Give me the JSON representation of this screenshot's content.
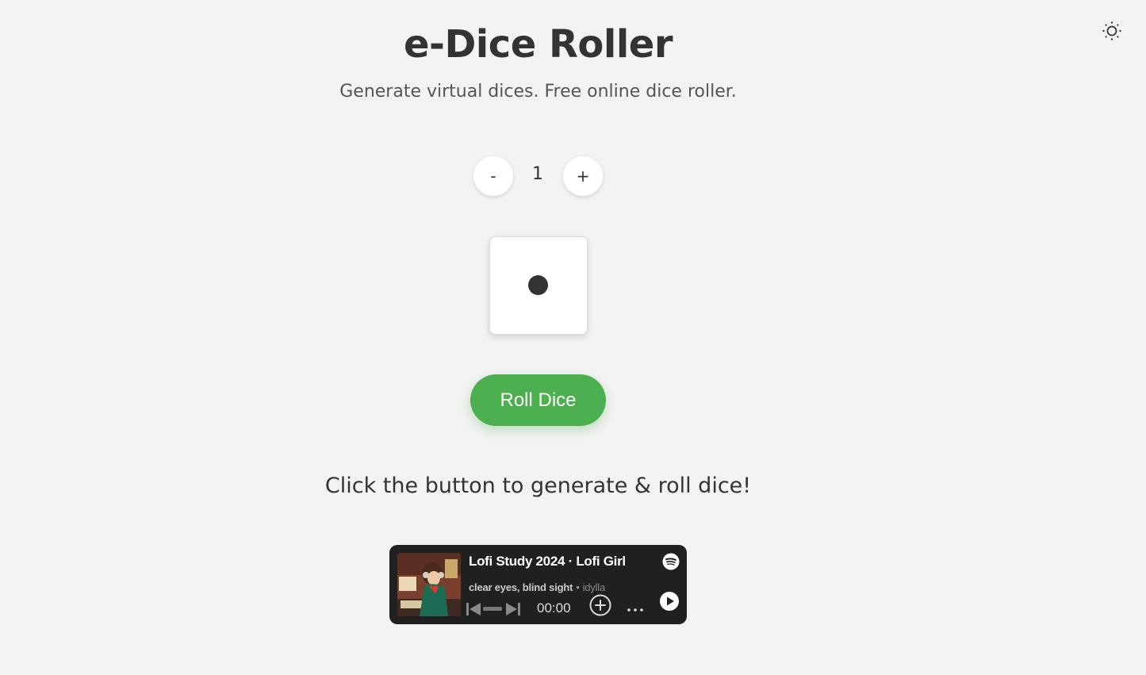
{
  "header": {
    "title": "e-Dice Roller",
    "subtitle": "Generate virtual dices. Free online dice roller.",
    "theme_toggle_icon": "sun-icon"
  },
  "dice_controls": {
    "decrease_label": "-",
    "count": "1",
    "increase_label": "+"
  },
  "dice": {
    "faces": [
      1
    ]
  },
  "roll_button": {
    "label": "Roll Dice",
    "color": "#4caf50"
  },
  "hint": "Click the button to generate & roll dice!",
  "player": {
    "title": "Lofi Study 2024 · Lofi Girl",
    "song": "clear eyes, blind sight",
    "separator": "•",
    "artist": "idylla",
    "time": "00:00",
    "progress": 0,
    "icons": {
      "logo": "spotify-icon",
      "previous": "skip-previous-icon",
      "next": "skip-next-icon",
      "add": "add-circle-icon",
      "more": "more-icon",
      "play": "play-icon"
    },
    "background": "#202020"
  }
}
